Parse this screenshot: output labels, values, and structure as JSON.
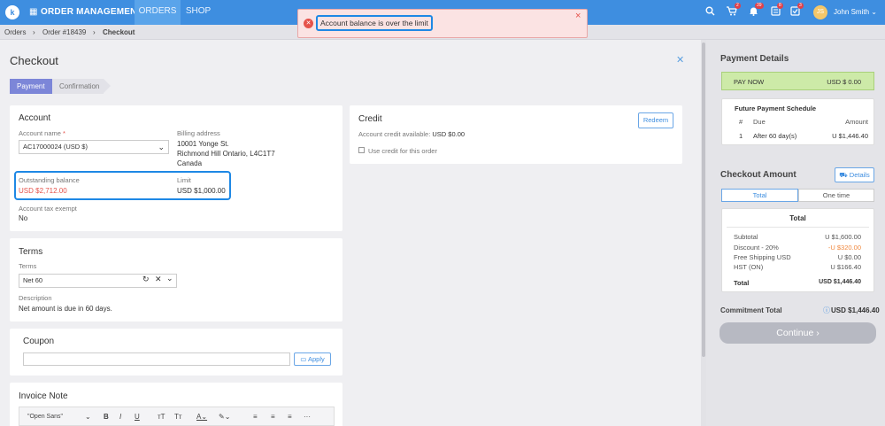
{
  "topbar": {
    "title": "ORDER MANAGEMENT",
    "tabs": [
      "ORDERS",
      "SHOP"
    ],
    "badges": {
      "cart": "2",
      "bell": "39",
      "reviews": "8",
      "tasks": "3"
    },
    "user": "John Smith",
    "avatar": "JS"
  },
  "breadcrumb": {
    "items": [
      "Orders",
      "Order #18439",
      "Checkout"
    ]
  },
  "alert": {
    "message": "Account balance is over the limit"
  },
  "checkout": {
    "title": "Checkout",
    "steps": [
      "Payment",
      "Confirmation"
    ]
  },
  "account": {
    "heading": "Account",
    "account_name_label": "Account name",
    "required_mark": "*",
    "account_name_value": "AC17000024 (USD $)",
    "billing_label": "Billing address",
    "billing_lines": [
      "10001 Yonge St.",
      "Richmond Hill Ontario, L4C1T7",
      "Canada"
    ],
    "outstanding_label": "Outstanding balance",
    "outstanding_value": "USD $2,712.00",
    "limit_label": "Limit",
    "limit_value": "USD $1,000.00",
    "tax_label": "Account tax exempt",
    "tax_value": "No"
  },
  "credit": {
    "heading": "Credit",
    "redeem": "Redeem",
    "available_label": "Account credit available:",
    "available_value": "USD $0.00",
    "use_label": "Use credit for this order"
  },
  "terms": {
    "heading": "Terms",
    "terms_label": "Terms",
    "terms_value": "Net 60",
    "description_label": "Description",
    "description_value": "Net amount is due in 60 days."
  },
  "coupon": {
    "heading": "Coupon",
    "apply": "Apply"
  },
  "invoice_note": {
    "heading": "Invoice Note",
    "font_value": "\"Open Sans\""
  },
  "payment_details": {
    "heading": "Payment Details",
    "pay_now_label": "PAY NOW",
    "pay_now_value": "USD $ 0.00",
    "schedule": {
      "title": "Future Payment Schedule",
      "headers": [
        "#",
        "Due",
        "Amount"
      ],
      "rows": [
        [
          "1",
          "After 60 day(s)",
          "U $1,446.40"
        ]
      ]
    }
  },
  "checkout_amount": {
    "heading": "Checkout Amount",
    "details": "Details",
    "tabs": [
      "Total",
      "One time"
    ],
    "total_title": "Total",
    "rows": [
      [
        "Subtotal",
        "U $1,600.00"
      ],
      [
        "Discount - 20%",
        "-U $320.00"
      ],
      [
        "Free Shipping USD",
        "U $0.00"
      ],
      [
        "HST (ON)",
        "U $166.40"
      ]
    ],
    "total_label": "Total",
    "total_value": "USD $1,446.40"
  },
  "commitment": {
    "label": "Commitment Total",
    "value": "USD $1,446.40"
  },
  "continue": "Continue",
  "colors": {
    "topbar": "#3e8ee0",
    "alert_bg": "#fbe3e3",
    "highlight": "#1e88e5",
    "pay_now_bg": "#cdeaa8",
    "danger": "#e5534b",
    "discount": "#f0883e",
    "step_active": "#7c86d8"
  }
}
